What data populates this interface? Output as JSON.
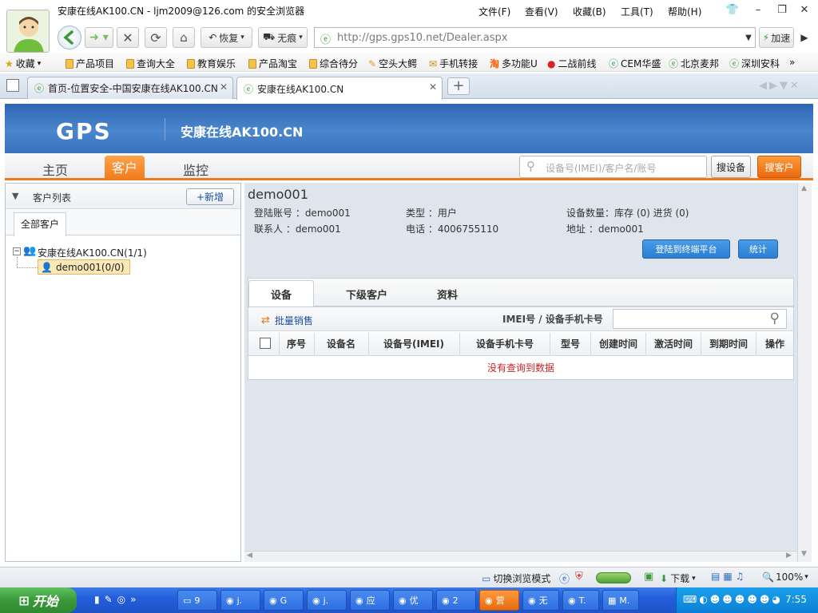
{
  "window": {
    "title": "安康在线AK100.CN - ljm2009@126.com 的安全浏览器",
    "menu": [
      "文件(F)",
      "查看(V)",
      "收藏(B)",
      "工具(T)",
      "帮助(H)"
    ]
  },
  "nav": {
    "restore_label": "恢复",
    "notrace_label": "无痕",
    "url": "http://gps.gps10.net/Dealer.aspx",
    "accelerate_label": "加速"
  },
  "bookmarks": {
    "favorites_label": "收藏",
    "items": [
      "产品项目",
      "查询大全",
      "教育娱乐",
      "产品淘宝",
      "综合待分",
      "空头大鳄",
      "手机转接",
      "多功能U",
      "二战前线",
      "CEM华盛",
      "北京麦邦",
      "深圳安科"
    ]
  },
  "tabs": [
    {
      "label": "首页-位置安全-中国安康在线AK100.CN"
    },
    {
      "label": "安康在线AK100.CN"
    }
  ],
  "site": {
    "logo": "GPS",
    "name": "安康在线AK100.CN",
    "nav": [
      "主页",
      "客户",
      "监控"
    ],
    "search_placeholder": "设备号(IMEI)/客户名/账号",
    "search_device_label": "搜设备",
    "search_customer_label": "搜客户"
  },
  "left": {
    "title": "客户列表",
    "add_label": "+新增",
    "tab": "全部客户",
    "tree_root": "安康在线AK100.CN(1/1)",
    "tree_child": "demo001(0/0)"
  },
  "customer": {
    "name": "demo001",
    "login_label": "登陆账号 ：demo001",
    "type_label": "类型 ：用户",
    "device_count_label": "设备数量：库存 (0)  进货 (0)",
    "contact_label": "联系人 ：demo001",
    "phone_label": "电话 ：4006755110",
    "address_label": "地址 ：demo001",
    "login_platform_label": "登陆到终端平台",
    "stats_label": "统计"
  },
  "detail": {
    "tabs": [
      "设备",
      "下级客户",
      "资料"
    ],
    "batch_label": "批量销售",
    "filter_label": "IMEI号 / 设备手机卡号",
    "columns": [
      "序号",
      "设备名",
      "设备号(IMEI)",
      "设备手机卡号",
      "型号",
      "创建时间",
      "激活时间",
      "到期时间",
      "操作"
    ],
    "empty_message": "没有查询到数据"
  },
  "statusbar": {
    "switch_mode_label": "切换浏览模式",
    "download_label": "下载",
    "zoom": "100%"
  },
  "taskbar": {
    "start_label": "开始",
    "tasks": [
      "9",
      "j.",
      "G",
      "j.",
      "应",
      "优",
      "2",
      "营",
      "无",
      "T.",
      "M."
    ],
    "time": "7:55"
  },
  "colors": {
    "accent_orange": "#f07a1a",
    "header_blue": "#3a72be",
    "button_blue": "#2a7fd3",
    "empty_red": "#cc2222"
  }
}
